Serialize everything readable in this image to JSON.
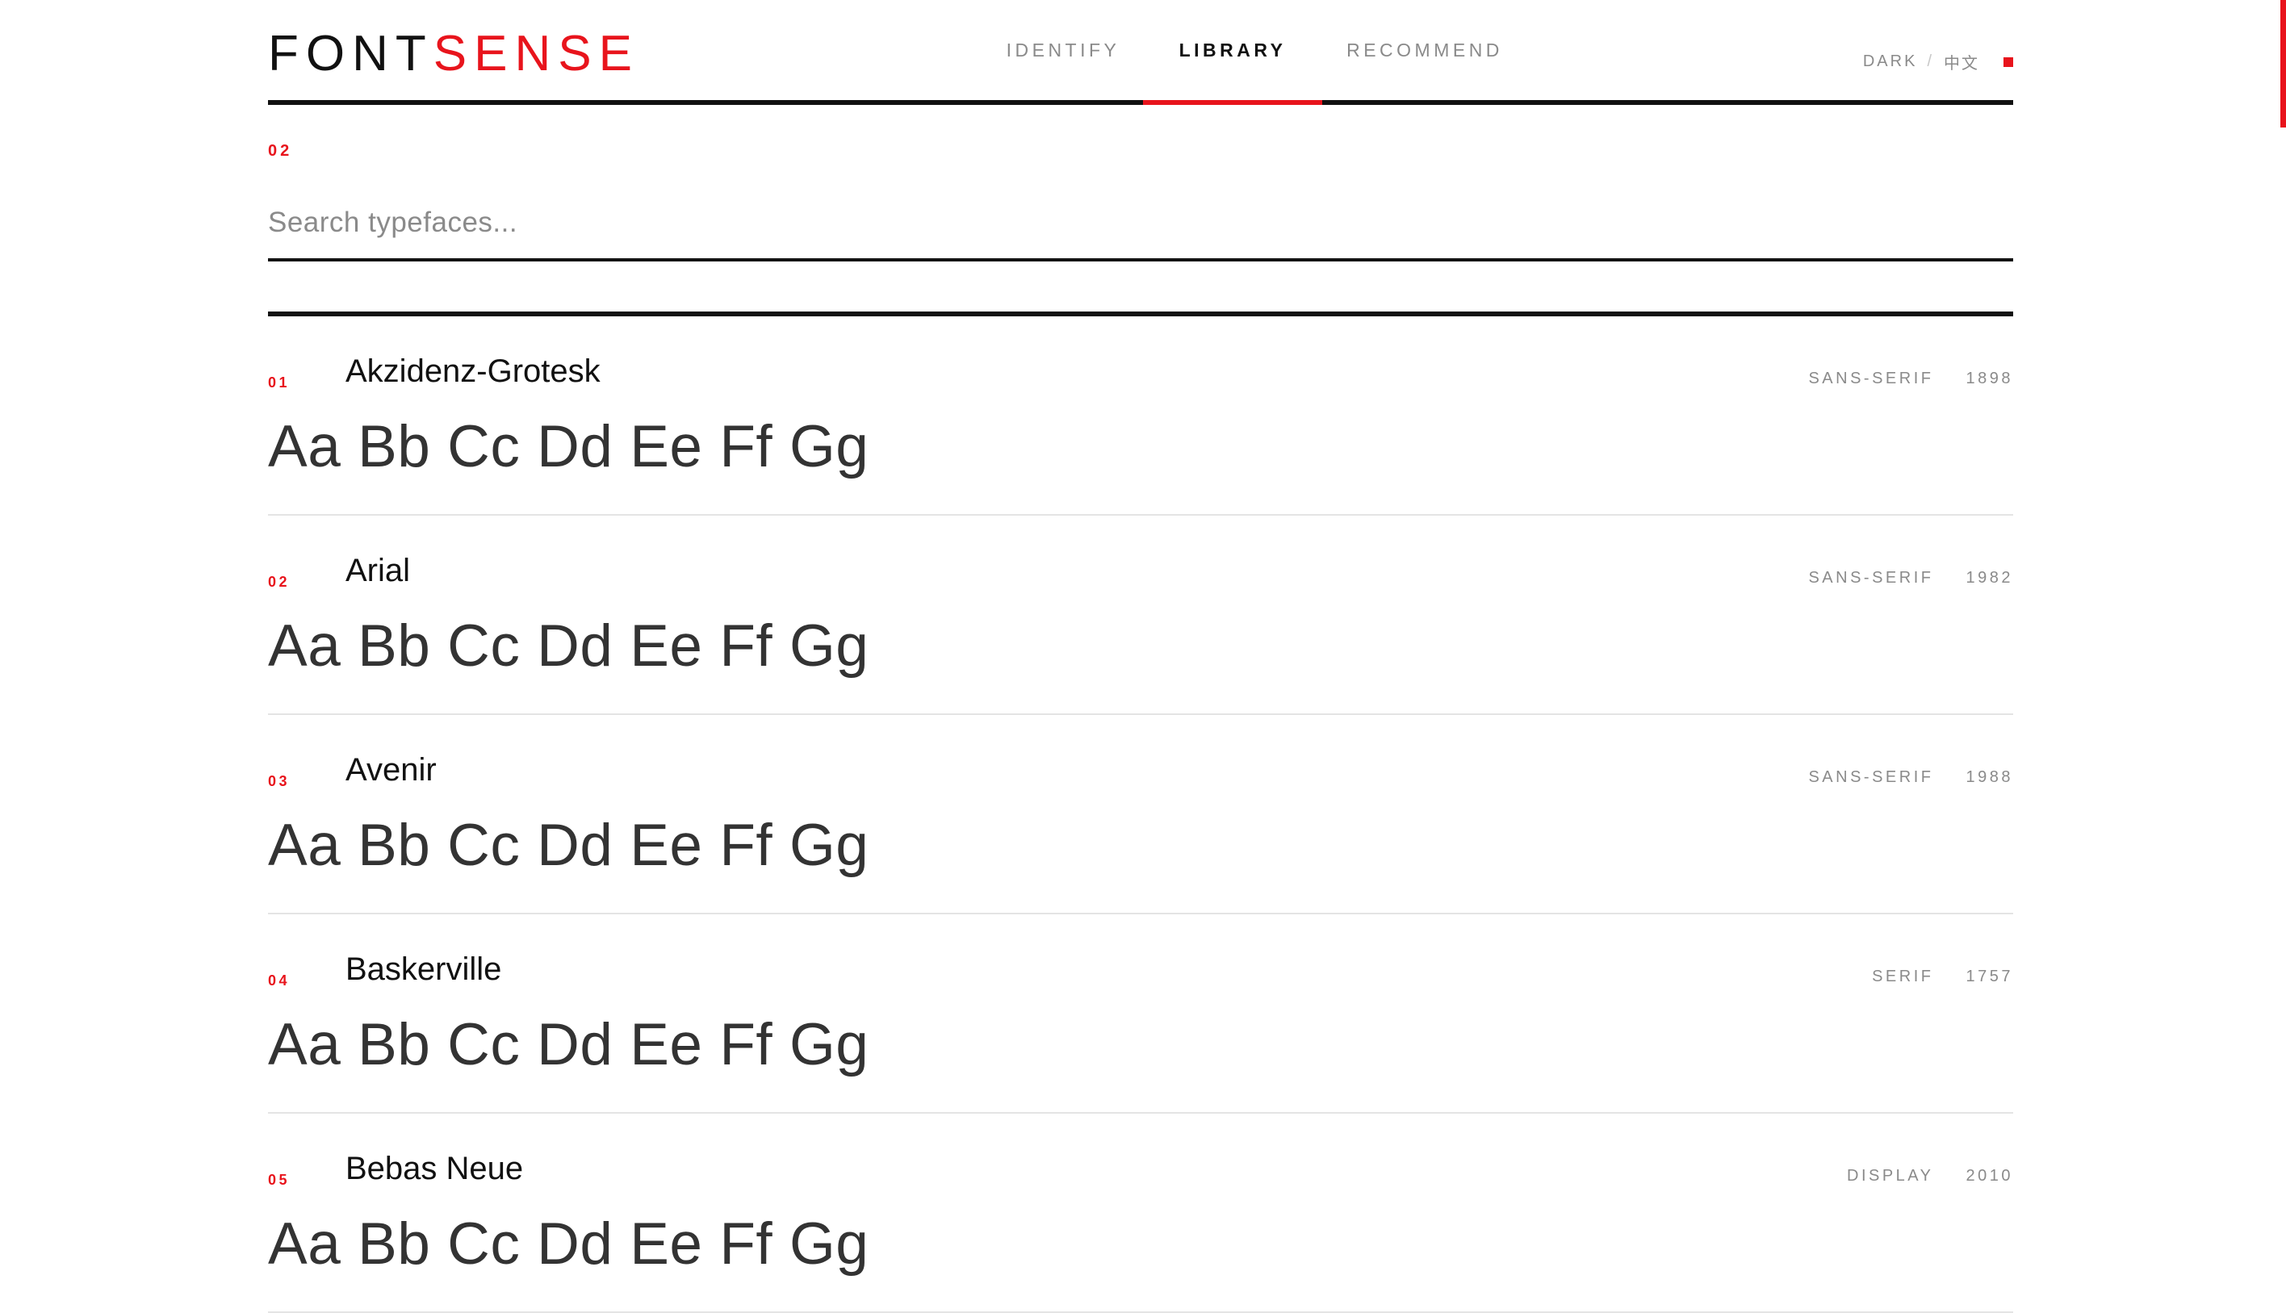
{
  "logo": {
    "part1": "FONT",
    "part2": "SENSE"
  },
  "nav": [
    {
      "label": "IDENTIFY"
    },
    {
      "label": "LIBRARY"
    },
    {
      "label": "RECOMMEND"
    }
  ],
  "header_right": {
    "theme": "DARK",
    "separator": "/",
    "language": "中文"
  },
  "section_number": "02",
  "search": {
    "placeholder": "Search typefaces...",
    "value": ""
  },
  "fonts": [
    {
      "num": "01",
      "name": "Akzidenz-Grotesk",
      "category": "SANS-SERIF",
      "year": "1898",
      "sample": "Aa Bb Cc Dd Ee Ff Gg"
    },
    {
      "num": "02",
      "name": "Arial",
      "category": "SANS-SERIF",
      "year": "1982",
      "sample": "Aa Bb Cc Dd Ee Ff Gg"
    },
    {
      "num": "03",
      "name": "Avenir",
      "category": "SANS-SERIF",
      "year": "1988",
      "sample": "Aa Bb Cc Dd Ee Ff Gg"
    },
    {
      "num": "04",
      "name": "Baskerville",
      "category": "SERIF",
      "year": "1757",
      "sample": "Aa Bb Cc Dd Ee Ff Gg"
    },
    {
      "num": "05",
      "name": "Bebas Neue",
      "category": "DISPLAY",
      "year": "2010",
      "sample": "Aa Bb Cc Dd Ee Ff Gg"
    }
  ],
  "colors": {
    "accent": "#e8141c",
    "text": "#111111",
    "muted": "#8a8a8a"
  }
}
